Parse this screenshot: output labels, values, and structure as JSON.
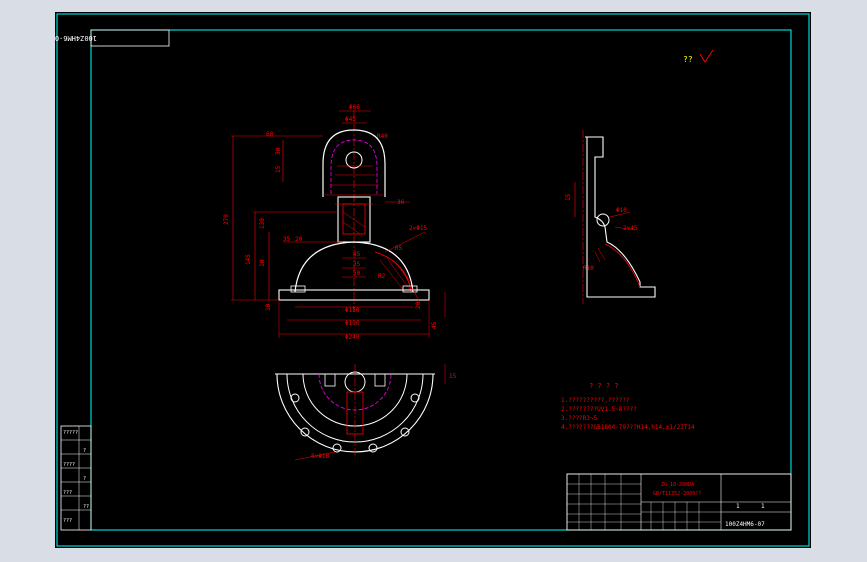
{
  "drawing": {
    "code_box": "100Z4HM6-07",
    "roughness_mark": "??",
    "notes_title": "? ? ? ?",
    "notes": [
      "1.??????????,??????",
      "2.????????UV1.5~8????",
      "3.????R3~5",
      "4.???????GB1804-79???H14,h14,±1/2IT14"
    ],
    "title_block": {
      "material_1": "ZG 10-200DA",
      "material_2": "GB/T11352-2009??",
      "scale": "1",
      "sheet": "1",
      "drawing_no": "100Z4HM6-07"
    },
    "dims_front": [
      "Φ66",
      "Φ45",
      "60",
      "R40",
      "270",
      "30",
      "15",
      "35",
      "10",
      "145",
      "130",
      "20",
      "45",
      "35",
      "50",
      "R5",
      "Φ150",
      "Φ190",
      "Φ240",
      "20",
      "45",
      "10",
      "36",
      "2×Φ15",
      "R2"
    ],
    "dims_side": [
      "Φ10",
      "15",
      "R10",
      "2×45"
    ],
    "dims_plan": [
      "8×Φ18",
      "15"
    ],
    "left_strip": [
      "?????",
      "?",
      "????",
      "?",
      "???",
      "??",
      "???"
    ]
  },
  "colors": {
    "background": "#000000",
    "frame": "#00ffff",
    "outline": "#ffffff",
    "dimension": "#ff0000",
    "centerline": "#ff0000",
    "hidden": "#ff00ff",
    "hatch": "#ff0000",
    "text": "#ffff00"
  }
}
